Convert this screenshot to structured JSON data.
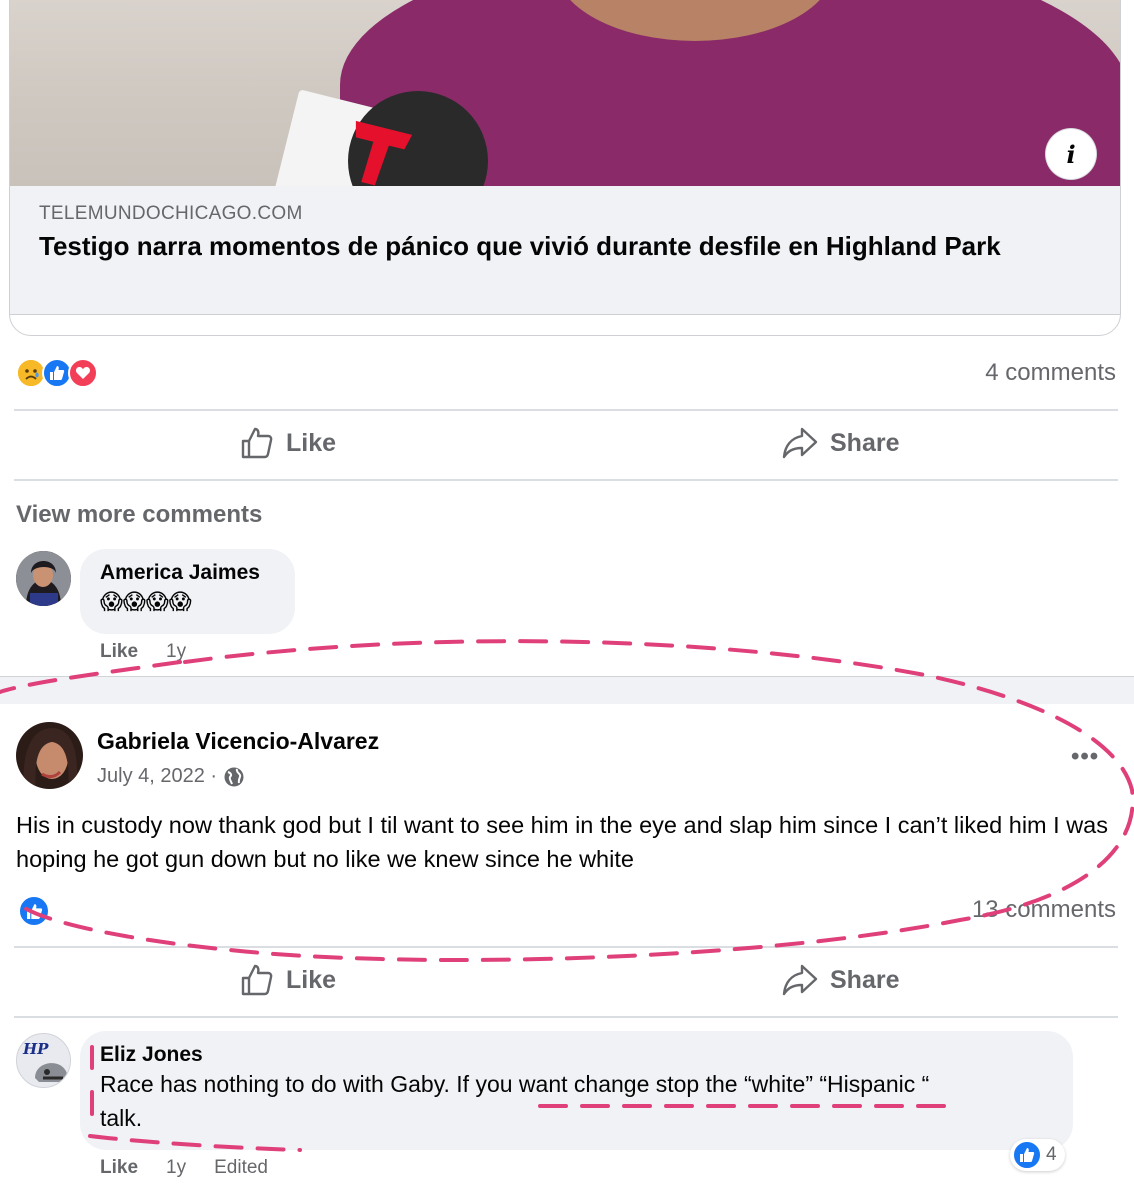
{
  "link_preview": {
    "logo_letter": "T",
    "info_glyph": "i",
    "domain": "TELEMUNDOCHICAGO.COM",
    "title": "Testigo narra momentos de pánico que vivió durante desfile en Highland Park"
  },
  "shared_post": {
    "reactions": [
      "sad-face-icon",
      "like-icon",
      "love-icon"
    ],
    "comment_count": "4 comments",
    "like_label": "Like",
    "share_label": "Share",
    "view_more": "View more comments",
    "comment": {
      "author": "America Jaimes",
      "text": "😱😱😱😱",
      "like_label": "Like",
      "time": "1y"
    }
  },
  "post": {
    "author": "Gabriela Vicencio-Alvarez",
    "date": "July 4, 2022 ·",
    "privacy_icon": "globe-icon",
    "more_label": "•••",
    "body": "His in custody now thank god but I til want to see him in the eye and slap him since I can’t liked him I was hoping he got gun down but no like we knew since he white",
    "reaction": "like-icon",
    "comment_count": "13 comments",
    "like_label": "Like",
    "share_label": "Share",
    "reply": {
      "avatar_text": "HP",
      "author": "Eliz Jones",
      "text": "Race has nothing to do with Gaby. If you want change stop the “white” “Hispanic “ talk.",
      "like_label": "Like",
      "time": "1y",
      "edited": "Edited",
      "reaction_count": "4"
    }
  },
  "colors": {
    "accent_blue": "#1877f2",
    "secondary_text": "#65676b",
    "bubble_bg": "#f0f2f5",
    "annotation_pink": "#e0407a"
  }
}
